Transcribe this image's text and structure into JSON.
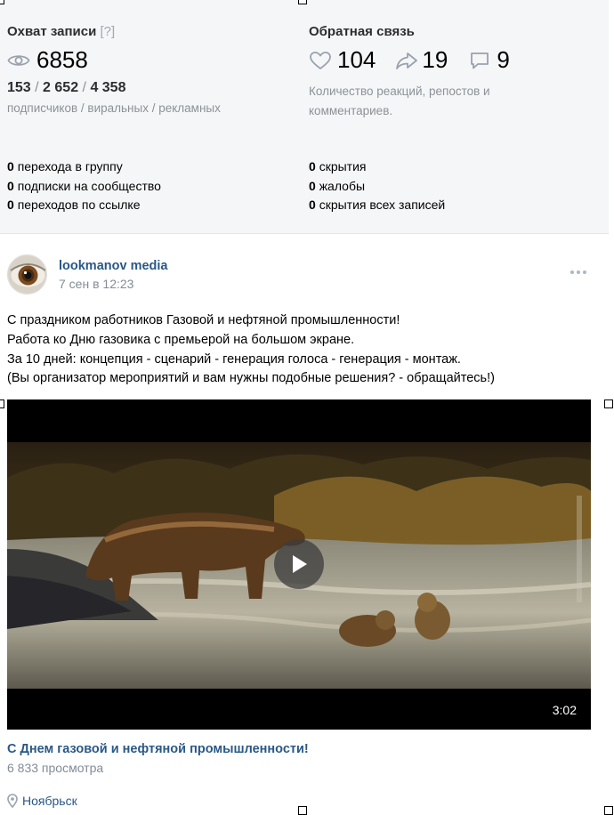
{
  "reach": {
    "title": "Охват записи",
    "help": "[?]",
    "icon": "eye-icon",
    "views": "6858",
    "subscribers": "153",
    "viral": "2 652",
    "ads": "4 358",
    "sep": " / ",
    "legend": "подписчиков / виральных / рекламных"
  },
  "feedback": {
    "title": "Обратная связь",
    "likes": "104",
    "reposts": "19",
    "comments": "9",
    "description": "Количество реакций, репостов и комментариев.",
    "icons": [
      "heart-icon",
      "repost-icon",
      "comment-icon"
    ]
  },
  "actions_left": [
    {
      "count": "0",
      "label": "перехода в группу"
    },
    {
      "count": "0",
      "label": "подписки на сообщество"
    },
    {
      "count": "0",
      "label": "переходов по ссылке"
    }
  ],
  "actions_right": [
    {
      "count": "0",
      "label": "скрытия"
    },
    {
      "count": "0",
      "label": "жалобы"
    },
    {
      "count": "0",
      "label": "скрытия всех записей"
    }
  ],
  "post": {
    "author": "lookmanov media",
    "date": "7 сен в 12:23",
    "text_lines": [
      "С праздником работников Газовой и нефтяной промышленности!",
      "Работа ко Дню газовика с премьерой на большом экране.",
      "За 10 дней: концепция - сценарий - генерация голоса - генерация - монтаж.",
      "(Вы организатор мероприятий и вам нужны подобные решения? - обращайтесь!)"
    ],
    "video": {
      "duration": "3:02",
      "title": "С Днем газовой и нефтяной промышленности!",
      "views": "6 833 просмотра"
    },
    "location": "Ноябрьск"
  },
  "colors": {
    "link": "#2a5885",
    "secondary": "#818c99",
    "panel_bg": "#f5f6f8"
  }
}
